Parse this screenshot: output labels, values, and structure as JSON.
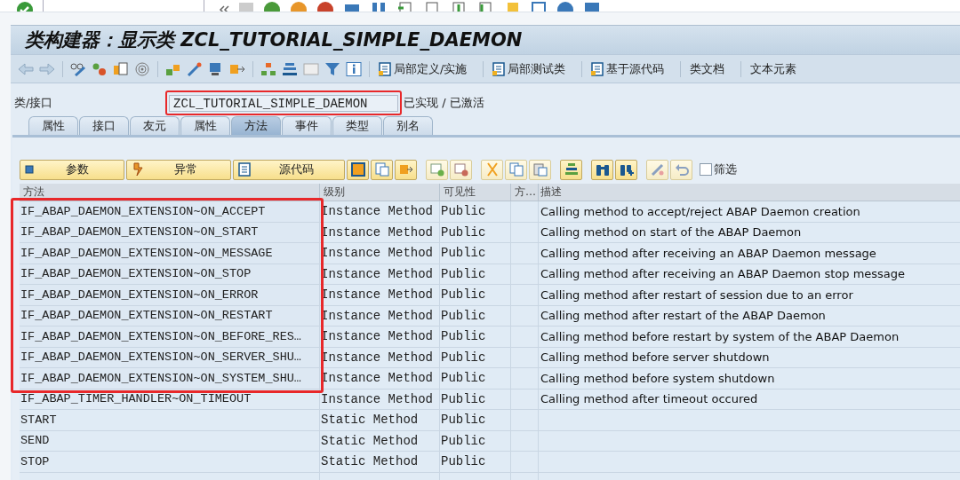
{
  "window": {
    "title": "类构建器：显示类 ZCL_TUTORIAL_SIMPLE_DAEMON"
  },
  "app_toolbar": {
    "buttons": [
      {
        "label": "局部定义/实施",
        "kind": "icon"
      },
      {
        "label": "局部测试类",
        "kind": "icon"
      },
      {
        "label": "基于源代码",
        "kind": "icon"
      },
      {
        "label": "类文档",
        "kind": "text"
      },
      {
        "label": "文本元素",
        "kind": "text"
      }
    ]
  },
  "class_field": {
    "label": "类/接口",
    "value": "ZCL_TUTORIAL_SIMPLE_DAEMON",
    "status": "已实现 / 已激活",
    "highlighted": true
  },
  "tabs": [
    {
      "label": "属性",
      "selected": false
    },
    {
      "label": "接口",
      "selected": false
    },
    {
      "label": "友元",
      "selected": false
    },
    {
      "label": "属性",
      "selected": false
    },
    {
      "label": "方法",
      "selected": true
    },
    {
      "label": "事件",
      "selected": false
    },
    {
      "label": "类型",
      "selected": false
    },
    {
      "label": "别名",
      "selected": false
    }
  ],
  "table_toolbar": {
    "buttons": [
      {
        "label": "参数",
        "kind": "param"
      },
      {
        "label": "异常",
        "kind": "exception"
      },
      {
        "label": "源代码",
        "kind": "source"
      }
    ],
    "filter": {
      "label": "筛选",
      "checked": false
    }
  },
  "table": {
    "columns": [
      "方法",
      "级别",
      "可见性",
      "方…",
      "描述"
    ],
    "rows": [
      {
        "method": "IF_ABAP_DAEMON_EXTENSION~ON_ACCEPT",
        "level": "Instance Method",
        "visibility": "Public",
        "description": "Calling method to accept/reject ABAP Daemon creation",
        "highlighted": true
      },
      {
        "method": "IF_ABAP_DAEMON_EXTENSION~ON_START",
        "level": "Instance Method",
        "visibility": "Public",
        "description": "Calling method on start of the ABAP Daemon",
        "highlighted": true
      },
      {
        "method": "IF_ABAP_DAEMON_EXTENSION~ON_MESSAGE",
        "level": "Instance Method",
        "visibility": "Public",
        "description": "Calling method after receiving an ABAP Daemon message",
        "highlighted": true
      },
      {
        "method": "IF_ABAP_DAEMON_EXTENSION~ON_STOP",
        "level": "Instance Method",
        "visibility": "Public",
        "description": "Calling method after receiving an ABAP Daemon stop message",
        "highlighted": true
      },
      {
        "method": "IF_ABAP_DAEMON_EXTENSION~ON_ERROR",
        "level": "Instance Method",
        "visibility": "Public",
        "description": "Calling method after restart of session due to an error",
        "highlighted": true
      },
      {
        "method": "IF_ABAP_DAEMON_EXTENSION~ON_RESTART",
        "level": "Instance Method",
        "visibility": "Public",
        "description": "Calling method after restart of the ABAP Daemon",
        "highlighted": true
      },
      {
        "method": "IF_ABAP_DAEMON_EXTENSION~ON_BEFORE_RES…",
        "level": "Instance Method",
        "visibility": "Public",
        "description": "Calling method before restart by system of the ABAP Daemon",
        "highlighted": true
      },
      {
        "method": "IF_ABAP_DAEMON_EXTENSION~ON_SERVER_SHU…",
        "level": "Instance Method",
        "visibility": "Public",
        "description": "Calling method before server shutdown",
        "highlighted": true
      },
      {
        "method": "IF_ABAP_DAEMON_EXTENSION~ON_SYSTEM_SHU…",
        "level": "Instance Method",
        "visibility": "Public",
        "description": "Calling method before system shutdown",
        "highlighted": true
      },
      {
        "method": "IF_ABAP_TIMER_HANDLER~ON_TIMEOUT",
        "level": "Instance Method",
        "visibility": "Public",
        "description": "Calling method after timeout occured",
        "highlighted": false
      },
      {
        "method": "START",
        "level": "Static Method",
        "visibility": "Public",
        "highlighted": false
      },
      {
        "method": "SEND",
        "level": "Static Method",
        "visibility": "Public",
        "highlighted": false
      },
      {
        "method": "STOP",
        "level": "Static Method",
        "visibility": "Public",
        "highlighted": false
      }
    ]
  }
}
